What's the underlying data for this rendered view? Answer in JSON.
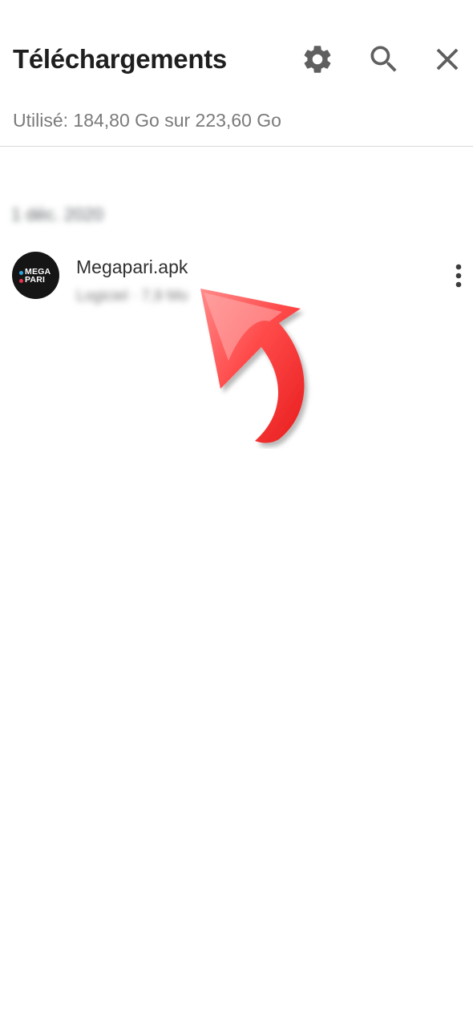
{
  "header": {
    "title": "Téléchargements",
    "icons": [
      "settings-icon",
      "search-icon",
      "close-icon"
    ]
  },
  "storage": {
    "text": "Utilisé: 184,80 Go sur 223,60 Go"
  },
  "downloads": {
    "date_header": "1 déc. 2020",
    "items": [
      {
        "file_name": "Megapari.apk",
        "meta": "Logiciel · 7,9 Mo",
        "logo": {
          "line1": "MEGA",
          "line2": "PARI"
        }
      }
    ]
  },
  "colors": {
    "accent_arrow": "#ff3b3b",
    "logo_background": "#151515",
    "logo_dot_blue": "#2aa7e0",
    "logo_dot_red": "#e8324a"
  }
}
